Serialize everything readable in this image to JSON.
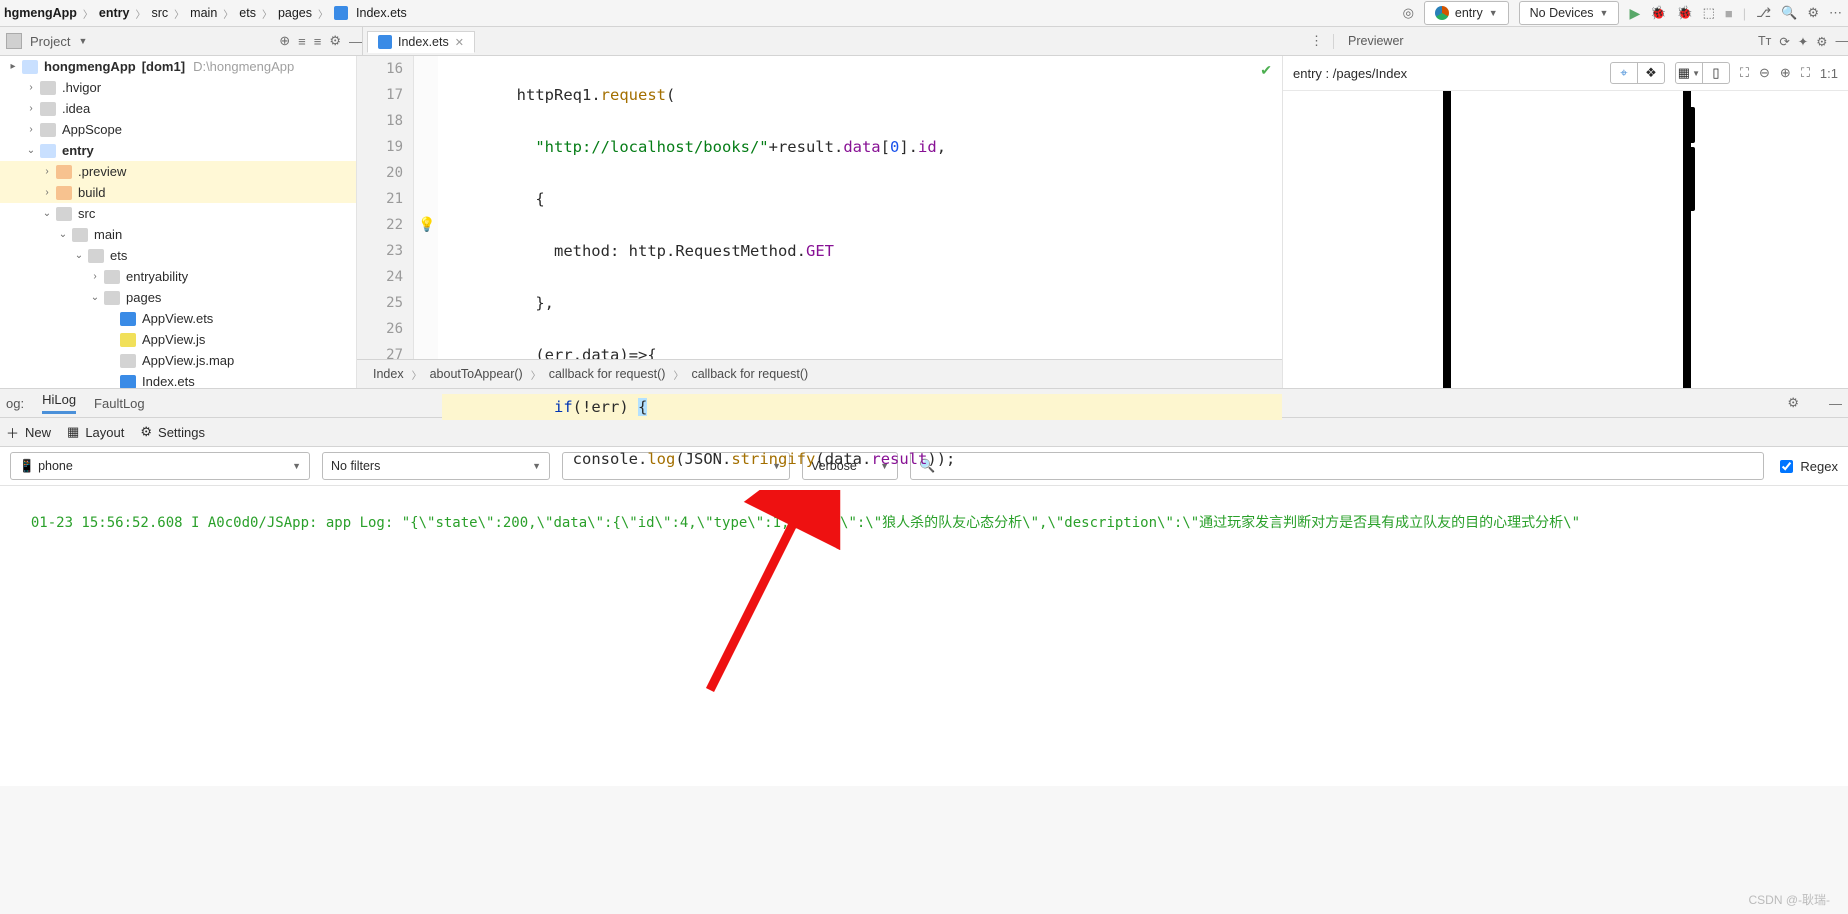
{
  "breadcrumb": {
    "root": "hgmengApp",
    "module": "entry",
    "p1": "src",
    "p2": "main",
    "p3": "ets",
    "p4": "pages",
    "file": "Index.ets"
  },
  "run_config": {
    "module_label": "entry",
    "device_label": "No Devices"
  },
  "project_panel": {
    "label": "Project"
  },
  "editor_tab": {
    "label": "Index.ets"
  },
  "previewer_label": "Previewer",
  "tree": {
    "root_name": "hongmengApp",
    "root_tag": "[dom1]",
    "root_path": "D:\\hongmengApp",
    "hvigor": ".hvigor",
    "idea": ".idea",
    "appscope": "AppScope",
    "entry": "entry",
    "preview": ".preview",
    "build": "build",
    "src": "src",
    "main": "main",
    "ets": "ets",
    "entryability": "entryability",
    "pages": "pages",
    "f_appview_ets": "AppView.ets",
    "f_appview_js": "AppView.js",
    "f_appview_map": "AppView.js.map",
    "f_index_ets": "Index.ets"
  },
  "gutter": [
    "16",
    "17",
    "18",
    "19",
    "20",
    "21",
    "22",
    "23",
    "24",
    "25",
    "26",
    "27"
  ],
  "code": {
    "l16": {
      "obj": "httpReq1",
      "dot": ".",
      "fn": "request",
      "paren": "("
    },
    "l17": {
      "str": "\"http://localhost/books/\"",
      "plus": "+",
      "r": "result",
      "d1": ".",
      "data": "data",
      "lb": "[",
      "idx": "0",
      "rb": "]",
      "d2": ".",
      "id": "id",
      "comma": ","
    },
    "l18": {
      "brace": "{"
    },
    "l19": {
      "key": "method",
      "colon": ": ",
      "http": "http",
      "dot": ".",
      "rm": "RequestMethod",
      "dot2": ".",
      "get": "GET"
    },
    "l20": {
      "brace": "}",
      "comma": ","
    },
    "l21": {
      "open": "(",
      "err": "err",
      "c1": ",",
      "data": "data",
      "close": ")",
      "arrow": "=>",
      "brace": "{"
    },
    "l22": {
      "kw": "if",
      "open": "(",
      "bang": "!",
      "err": "err",
      "close": ") ",
      "brace": "{"
    },
    "l23": {
      "console": "console",
      "d": ".",
      "log": "log",
      "o": "(",
      "json": "JSON",
      "d2": ".",
      "str": "stringify",
      "o2": "(",
      "data": "data",
      "d3": ".",
      "res": "result",
      "c": ")",
      "c2": ")",
      "semi": ";"
    },
    "l24": {
      "brace": "}"
    },
    "l25": {
      "brace": "}"
    },
    "l26": {
      "paren": ")"
    },
    "l27": {
      "brace": "}"
    }
  },
  "editor_bcrumb": {
    "a": "Index",
    "b": "aboutToAppear()",
    "c": "callback for request()",
    "d": "callback for request()"
  },
  "previewer": {
    "path": "entry : /pages/Index"
  },
  "log_tabs": {
    "prefix": "og:",
    "hilog": "HiLog",
    "faultlog": "FaultLog"
  },
  "log_toolbar": {
    "new": "New",
    "layout": "Layout",
    "settings": "Settings"
  },
  "log_filter": {
    "device_icon": "📱",
    "device": "phone",
    "filters": "No filters",
    "level": "Verbose",
    "search_placeholder": "",
    "regex_label": "Regex"
  },
  "log_line": "01-23 15:56:52.608 I A0c0d0/JSApp: app Log: \"{\\\"state\\\":200,\\\"data\\\":{\\\"id\\\":4,\\\"type\\\":1,\\\"name\\\":\\\"狼人杀的队友心态分析\\\",\\\"description\\\":\\\"通过玩家发言判断对方是否具有成立队友的目的心理式分析\\\"",
  "watermark": "CSDN @-耿瑞-"
}
